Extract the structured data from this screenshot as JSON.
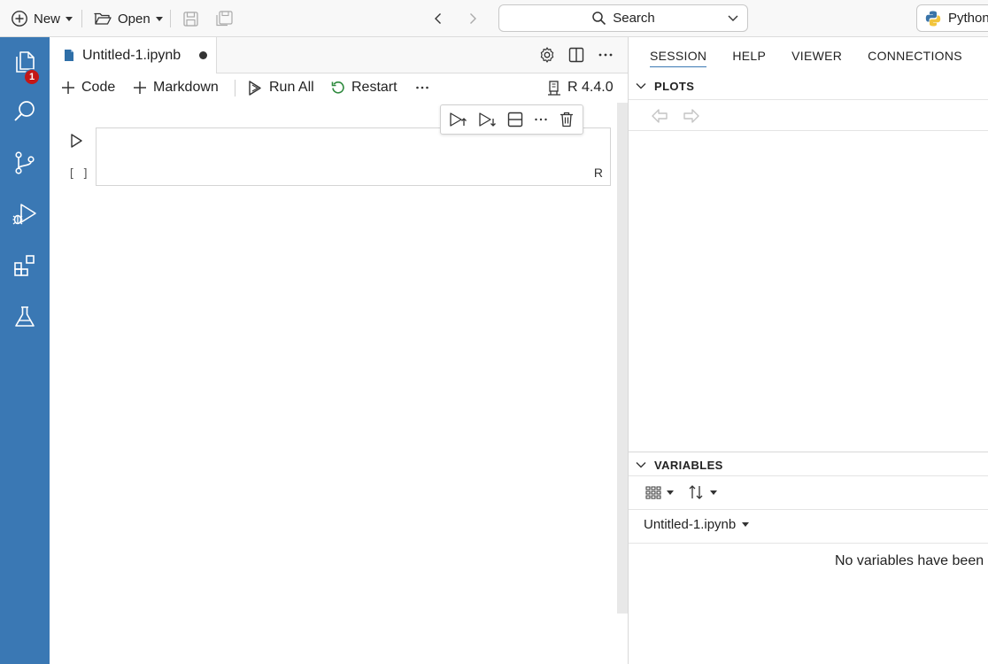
{
  "topbar": {
    "new_label": "New",
    "open_label": "Open",
    "search_label": "Search",
    "interpreter_label": "Python"
  },
  "activity": {
    "explorer_badge": "1",
    "items": [
      "explorer-icon",
      "search-icon",
      "source-control-icon",
      "run-debug-icon",
      "extensions-icon",
      "testing-icon"
    ]
  },
  "editor": {
    "tab_label": "Untitled-1.ipynb",
    "toolbar": {
      "code_label": "Code",
      "markdown_label": "Markdown",
      "run_all_label": "Run All",
      "restart_label": "Restart",
      "kernel_label": "R 4.4.0"
    },
    "cell": {
      "exec_count": "[ ]",
      "language": "R"
    }
  },
  "right_panel": {
    "tabs": [
      "SESSION",
      "HELP",
      "VIEWER",
      "CONNECTIONS"
    ],
    "active_tab": "SESSION",
    "plots_title": "PLOTS",
    "variables_title": "VARIABLES",
    "variables_source": "Untitled-1.ipynb",
    "variables_empty": "No variables have been"
  },
  "colors": {
    "activity_bar": "#3a78b4",
    "badge": "#c41717",
    "restart_icon": "#2e8a3e"
  }
}
